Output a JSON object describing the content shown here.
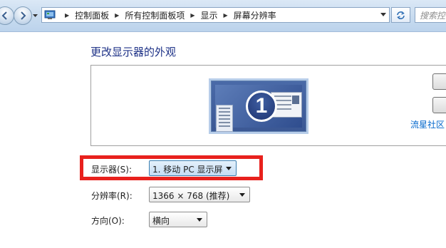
{
  "address_bar": {
    "breadcrumbs": [
      {
        "label": "控制面板"
      },
      {
        "label": "所有控制面板项"
      },
      {
        "label": "显示"
      },
      {
        "label": "屏幕分辨率"
      }
    ]
  },
  "search": {
    "placeholder": "搜索控"
  },
  "page": {
    "title": "更改显示器的外观"
  },
  "preview": {
    "monitor_number": "1"
  },
  "watermark_link": "流星社区",
  "form": {
    "display": {
      "label": "显示器(S):",
      "value": "1. 移动 PC 显示屏"
    },
    "resolution": {
      "label": "分辨率(R):",
      "value": "1366 × 768 (推荐)"
    },
    "orientation": {
      "label": "方向(O):",
      "value": "横向"
    }
  },
  "colors": {
    "title": "#1e3287",
    "highlight": "#e8211d",
    "link": "#0066cc"
  }
}
